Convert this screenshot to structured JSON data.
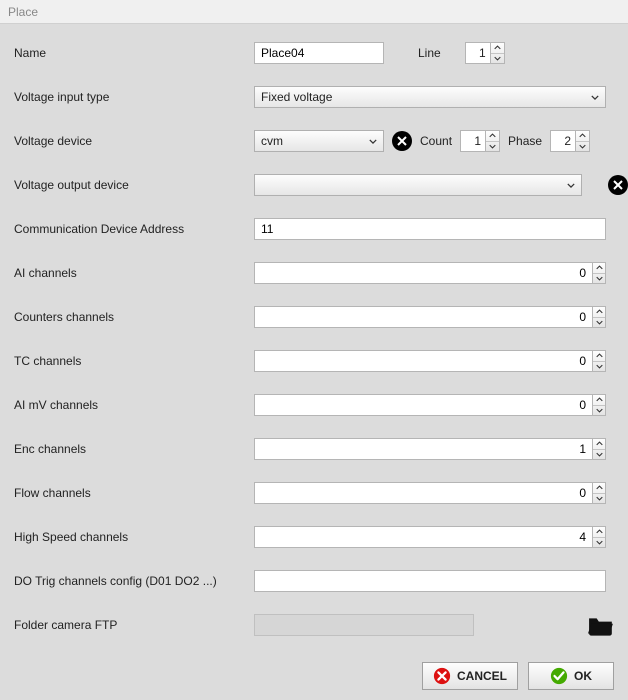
{
  "window": {
    "title": "Place"
  },
  "fields": {
    "name": {
      "label": "Name",
      "value": "Place04"
    },
    "line": {
      "label": "Line",
      "value": "1"
    },
    "vin_type": {
      "label": "Voltage input type",
      "value": "Fixed voltage"
    },
    "vdev": {
      "label": "Voltage device",
      "value": "cvm"
    },
    "count": {
      "label": "Count",
      "value": "1"
    },
    "phase": {
      "label": "Phase",
      "value": "2"
    },
    "vout": {
      "label": "Voltage output device",
      "value": ""
    },
    "commaddr": {
      "label": "Communication Device Address",
      "value": "11"
    },
    "ai": {
      "label": "AI channels",
      "value": "0"
    },
    "counters": {
      "label": "Counters channels",
      "value": "0"
    },
    "tc": {
      "label": "TC channels",
      "value": "0"
    },
    "aimv": {
      "label": "AI mV channels",
      "value": "0"
    },
    "enc": {
      "label": "Enc channels",
      "value": "1"
    },
    "flow": {
      "label": "Flow channels",
      "value": "0"
    },
    "hispeed": {
      "label": "High Speed channels",
      "value": "4"
    },
    "dotrig": {
      "label": "DO Trig channels config (D01 DO2 ...)",
      "value": ""
    },
    "ftp": {
      "label": "Folder camera FTP",
      "value": ""
    }
  },
  "buttons": {
    "cancel": "CANCEL",
    "ok": "OK"
  }
}
